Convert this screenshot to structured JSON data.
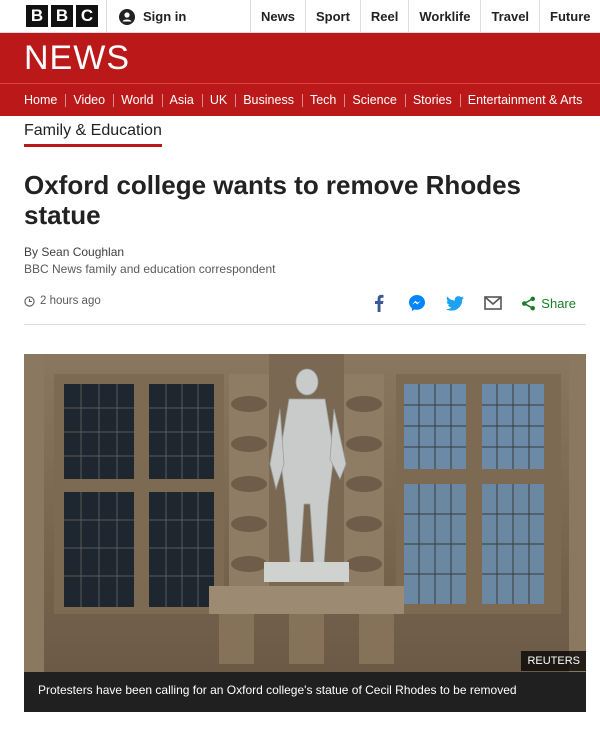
{
  "brand": {
    "bbc_letters": [
      "B",
      "B",
      "C"
    ]
  },
  "account": {
    "signin_label": "Sign in"
  },
  "top_nav": [
    "News",
    "Sport",
    "Reel",
    "Worklife",
    "Travel",
    "Future"
  ],
  "header": {
    "title": "NEWS",
    "color": "#bb1919"
  },
  "section_nav": [
    "Home",
    "Video",
    "World",
    "Asia",
    "UK",
    "Business",
    "Tech",
    "Science",
    "Stories",
    "Entertainment & Arts"
  ],
  "article": {
    "section": "Family & Education",
    "headline": "Oxford college wants to remove Rhodes statue",
    "author": "By Sean Coughlan",
    "author_role": "BBC News family and education correspondent",
    "timestamp": "2 hours ago",
    "share_label": "Share"
  },
  "image": {
    "credit": "REUTERS",
    "caption": "Protesters have been calling for an Oxford college's statue of Cecil Rhodes to be removed"
  },
  "share_icons": [
    "facebook-icon",
    "messenger-icon",
    "twitter-icon",
    "email-icon",
    "share-icon"
  ]
}
